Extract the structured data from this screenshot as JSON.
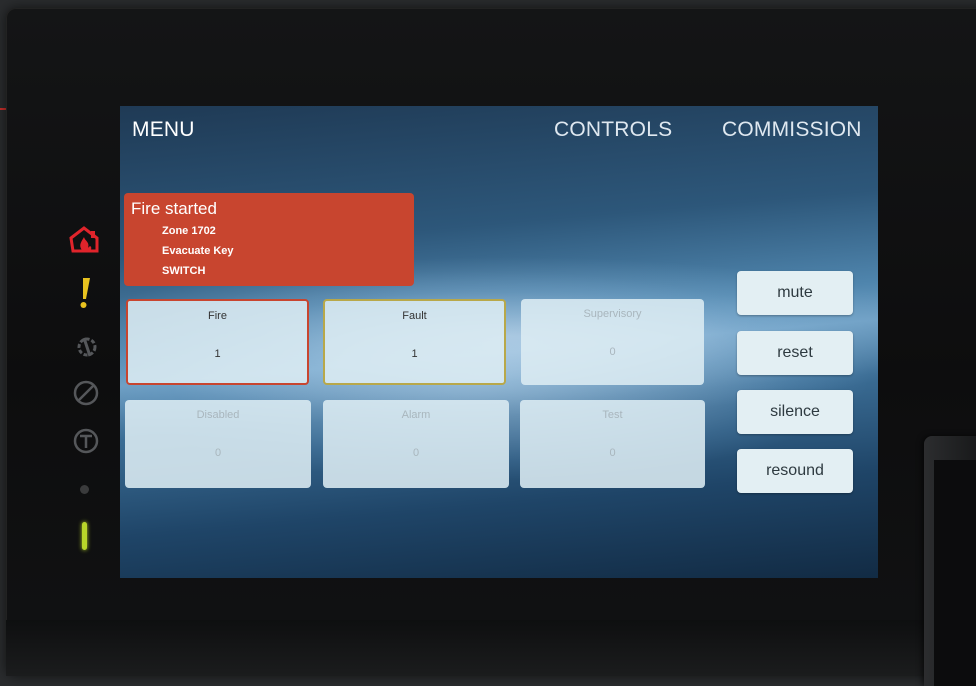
{
  "nav": {
    "menu": "MENU",
    "controls": "CONTROLS",
    "commission": "COMMISSION"
  },
  "alert": {
    "title": "Fire started",
    "lines": [
      "Zone 1702",
      "Evacuate Key",
      "SWITCH"
    ],
    "color": "#c8452f"
  },
  "status_tiles": [
    {
      "label": "Fire",
      "count": "1"
    },
    {
      "label": "Fault",
      "count": "1"
    },
    {
      "label": "Supervisory",
      "count": "0"
    },
    {
      "label": "Disabled",
      "count": "0"
    },
    {
      "label": "Alarm",
      "count": "0"
    },
    {
      "label": "Test",
      "count": "0"
    }
  ],
  "buttons": {
    "mute": "mute",
    "reset": "reset",
    "silence": "silence",
    "resound": "resound"
  },
  "indicators": [
    {
      "name": "fire-house-icon",
      "color": "#e0242b"
    },
    {
      "name": "exclamation-icon",
      "color": "#e8c21f"
    },
    {
      "name": "wrench-gear-icon",
      "color": "#5a5c5e"
    },
    {
      "name": "disabled-circle-icon",
      "color": "#5a5c5e"
    },
    {
      "name": "test-circle-icon",
      "color": "#5a5c5e"
    },
    {
      "name": "power-led",
      "color": "#b8d62a"
    }
  ]
}
